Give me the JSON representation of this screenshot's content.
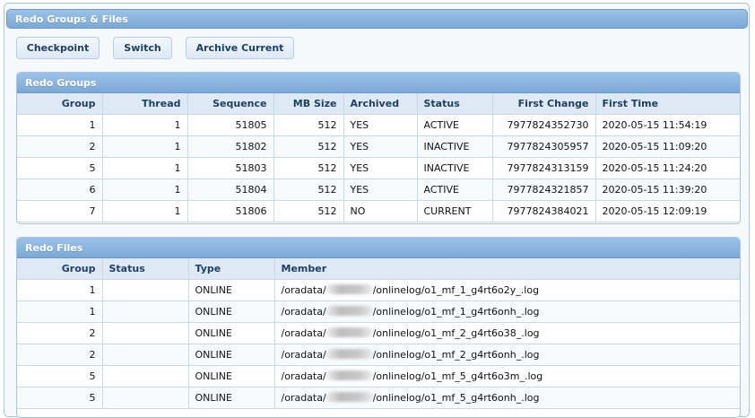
{
  "window": {
    "title": "Redo Groups & Files"
  },
  "toolbar": {
    "checkpoint": "Checkpoint",
    "switch": "Switch",
    "archive_current": "Archive Current"
  },
  "groups": {
    "title": "Redo Groups",
    "headers": {
      "group": "Group",
      "thread": "Thread",
      "sequence": "Sequence",
      "mb_size": "MB Size",
      "archived": "Archived",
      "status": "Status",
      "first_change": "First Change",
      "first_time": "First Time"
    },
    "rows": [
      {
        "group": "1",
        "thread": "1",
        "sequence": "51805",
        "mb_size": "512",
        "archived": "YES",
        "status": "ACTIVE",
        "first_change": "7977824352730",
        "first_time": "2020-05-15 11:54:19"
      },
      {
        "group": "2",
        "thread": "1",
        "sequence": "51802",
        "mb_size": "512",
        "archived": "YES",
        "status": "INACTIVE",
        "first_change": "7977824305957",
        "first_time": "2020-05-15 11:09:20"
      },
      {
        "group": "5",
        "thread": "1",
        "sequence": "51803",
        "mb_size": "512",
        "archived": "YES",
        "status": "INACTIVE",
        "first_change": "7977824313159",
        "first_time": "2020-05-15 11:24:20"
      },
      {
        "group": "6",
        "thread": "1",
        "sequence": "51804",
        "mb_size": "512",
        "archived": "YES",
        "status": "ACTIVE",
        "first_change": "7977824321857",
        "first_time": "2020-05-15 11:39:20"
      },
      {
        "group": "7",
        "thread": "1",
        "sequence": "51806",
        "mb_size": "512",
        "archived": "NO",
        "status": "CURRENT",
        "first_change": "7977824384021",
        "first_time": "2020-05-15 12:09:19"
      }
    ]
  },
  "files": {
    "title": "Redo Files",
    "headers": {
      "group": "Group",
      "status": "Status",
      "type": "Type",
      "member": "Member"
    },
    "rows": [
      {
        "group": "1",
        "status": "",
        "type": "ONLINE",
        "member_prefix": "/oradata/",
        "member_suffix": "/onlinelog/o1_mf_1_g4rt6o2y_.log"
      },
      {
        "group": "1",
        "status": "",
        "type": "ONLINE",
        "member_prefix": "/oradata/",
        "member_suffix": "/onlinelog/o1_mf_1_g4rt6onh_.log"
      },
      {
        "group": "2",
        "status": "",
        "type": "ONLINE",
        "member_prefix": "/oradata/",
        "member_suffix": "/onlinelog/o1_mf_2_g4rt6o38_.log"
      },
      {
        "group": "2",
        "status": "",
        "type": "ONLINE",
        "member_prefix": "/oradata/",
        "member_suffix": "/onlinelog/o1_mf_2_g4rt6onh_.log"
      },
      {
        "group": "5",
        "status": "",
        "type": "ONLINE",
        "member_prefix": "/oradata/",
        "member_suffix": "/onlinelog/o1_mf_5_g4rt6o3m_.log"
      },
      {
        "group": "5",
        "status": "",
        "type": "ONLINE",
        "member_prefix": "/oradata/",
        "member_suffix": "/onlinelog/o1_mf_5_g4rt6onh_.log"
      }
    ]
  }
}
